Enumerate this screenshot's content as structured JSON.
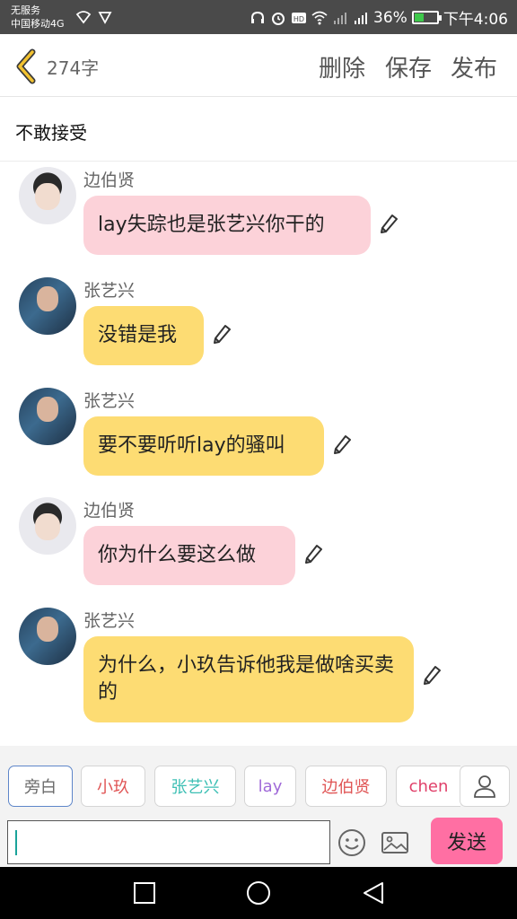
{
  "status_bar": {
    "carrier_line1": "无服务",
    "carrier_line2": "中国移动4G",
    "battery_percent": "36%",
    "time": "下午4:06",
    "network_label": "4G",
    "battery_level": 0.36,
    "icons": [
      "shield-icon",
      "headphones-icon",
      "alarm-icon",
      "hd-icon",
      "wifi-icon",
      "signal-icon",
      "battery-icon"
    ]
  },
  "header": {
    "char_count": "274字",
    "delete_label": "删除",
    "save_label": "保存",
    "publish_label": "发布"
  },
  "title": "不敢接受",
  "messages": [
    {
      "sender": "边伯贤",
      "text": "lay失踪也是张艺兴你干的",
      "bubble_color": "#fcd2d9",
      "avatar": "white"
    },
    {
      "sender": "张艺兴",
      "text": "没错是我",
      "bubble_color": "#fddc73",
      "avatar": "dark"
    },
    {
      "sender": "张艺兴",
      "text": "要不要听听lay的骚叫",
      "bubble_color": "#fddc73",
      "avatar": "dark"
    },
    {
      "sender": "边伯贤",
      "text": "你为什么要这么做",
      "bubble_color": "#fcd2d9",
      "avatar": "white"
    },
    {
      "sender": "张艺兴",
      "text": "为什么，小玖告诉他我是做啥买卖的",
      "bubble_color": "#fddc73",
      "avatar": "dark"
    }
  ],
  "roles": [
    {
      "label": "旁白",
      "color": "#6b6b6b"
    },
    {
      "label": "小玖",
      "color": "#e05555"
    },
    {
      "label": "张艺兴",
      "color": "#3cbfb4"
    },
    {
      "label": "lay",
      "color": "#a06ad8"
    },
    {
      "label": "边伯贤",
      "color": "#e05555"
    },
    {
      "label": "chen",
      "color": "#e0406a"
    }
  ],
  "composer": {
    "input_value": "",
    "send_label": "发送"
  },
  "colors": {
    "accent_yellow": "#fddc73",
    "accent_pink": "#fcd2d9",
    "send_button": "#ff6fa3",
    "back_arrow": "#f2c230"
  }
}
